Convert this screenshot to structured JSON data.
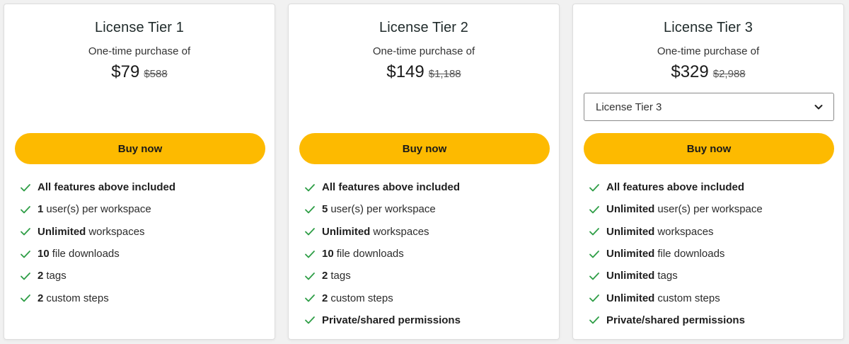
{
  "accent_color": "#fdba00",
  "check_color": "#2e9e46",
  "cards": [
    {
      "title": "License Tier 1",
      "purchase_label": "One-time purchase of",
      "price": "$79",
      "original_price": "$588",
      "buy_label": "Buy now",
      "features": [
        {
          "bold": "All features above included",
          "rest": ""
        },
        {
          "bold": "1",
          "rest": "user(s) per workspace"
        },
        {
          "bold": "Unlimited",
          "rest": "workspaces"
        },
        {
          "bold": "10",
          "rest": "file downloads"
        },
        {
          "bold": "2",
          "rest": "tags"
        },
        {
          "bold": "2",
          "rest": "custom steps"
        }
      ]
    },
    {
      "title": "License Tier 2",
      "purchase_label": "One-time purchase of",
      "price": "$149",
      "original_price": "$1,188",
      "buy_label": "Buy now",
      "features": [
        {
          "bold": "All features above included",
          "rest": ""
        },
        {
          "bold": "5",
          "rest": "user(s) per workspace"
        },
        {
          "bold": "Unlimited",
          "rest": "workspaces"
        },
        {
          "bold": "10",
          "rest": "file downloads"
        },
        {
          "bold": "2",
          "rest": "tags"
        },
        {
          "bold": "2",
          "rest": "custom steps"
        },
        {
          "bold": "Private/shared permissions",
          "rest": ""
        }
      ]
    },
    {
      "title": "License Tier 3",
      "purchase_label": "One-time purchase of",
      "price": "$329",
      "original_price": "$2,988",
      "select_value": "License Tier 3",
      "buy_label": "Buy now",
      "features": [
        {
          "bold": "All features above included",
          "rest": ""
        },
        {
          "bold": "Unlimited",
          "rest": "user(s) per workspace"
        },
        {
          "bold": "Unlimited",
          "rest": "workspaces"
        },
        {
          "bold": "Unlimited",
          "rest": "file downloads"
        },
        {
          "bold": "Unlimited",
          "rest": "tags"
        },
        {
          "bold": "Unlimited",
          "rest": "custom steps"
        },
        {
          "bold": "Private/shared permissions",
          "rest": ""
        }
      ]
    }
  ]
}
